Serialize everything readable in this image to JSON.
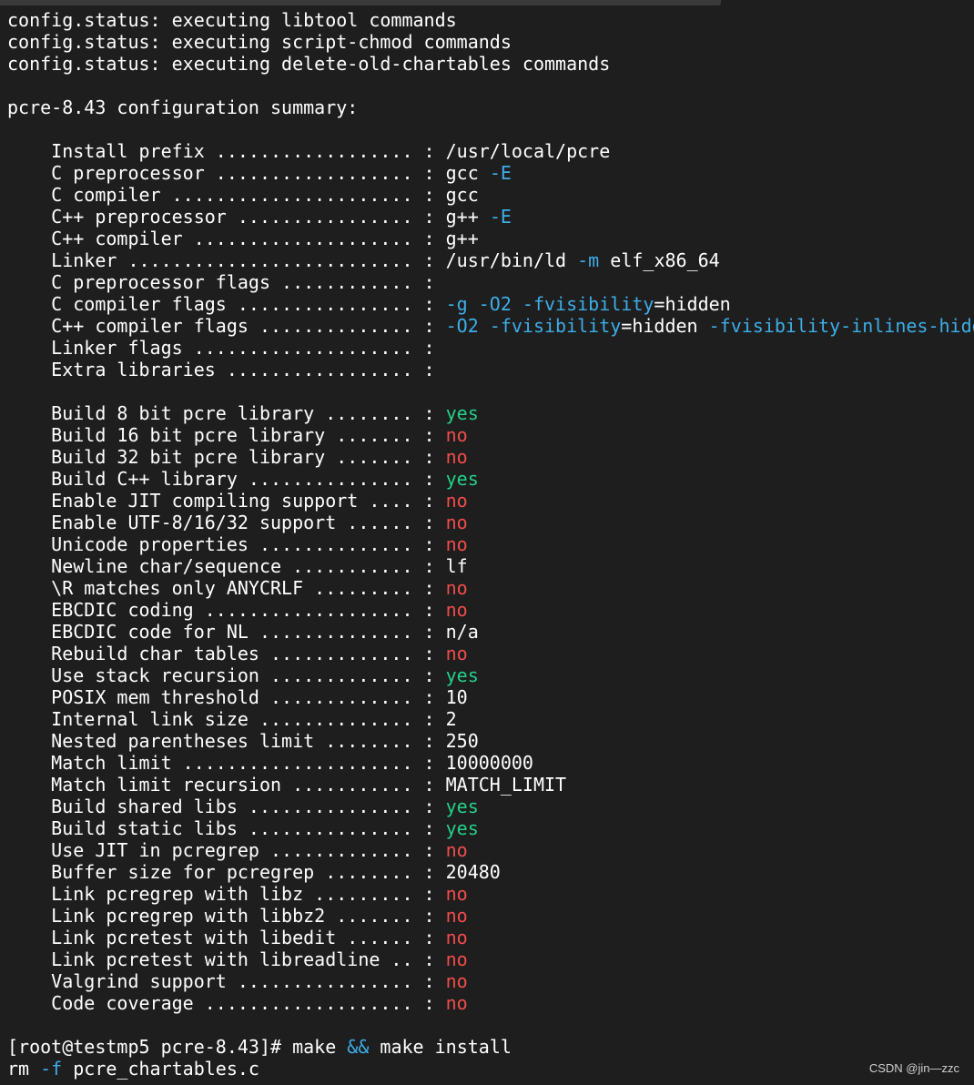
{
  "colors": {
    "background": "#1e1e1e",
    "white": "#ffffff",
    "blue": "#3daee9",
    "green": "#23d18b",
    "red": "#f14c4c"
  },
  "terminal": {
    "lines": [
      [
        {
          "t": "config.status: executing libtool commands",
          "c": "white"
        }
      ],
      [
        {
          "t": "config.status: executing script-chmod commands",
          "c": "white"
        }
      ],
      [
        {
          "t": "config.status: executing delete-old-chartables commands",
          "c": "white"
        }
      ],
      [],
      [
        {
          "t": "pcre-8.43 configuration summary:",
          "c": "white"
        }
      ],
      [],
      [
        {
          "t": "    Install prefix .................. : /usr/local/pcre",
          "c": "white"
        }
      ],
      [
        {
          "t": "    C preprocessor .................. : gcc ",
          "c": "white"
        },
        {
          "t": "-E",
          "c": "blue"
        }
      ],
      [
        {
          "t": "    C compiler ...................... : gcc",
          "c": "white"
        }
      ],
      [
        {
          "t": "    C++ preprocessor ................ : g++ ",
          "c": "white"
        },
        {
          "t": "-E",
          "c": "blue"
        }
      ],
      [
        {
          "t": "    C++ compiler .................... : g++",
          "c": "white"
        }
      ],
      [
        {
          "t": "    Linker .......................... : /usr/bin/ld ",
          "c": "white"
        },
        {
          "t": "-m",
          "c": "blue"
        },
        {
          "t": " elf_x86_64",
          "c": "white"
        }
      ],
      [
        {
          "t": "    C preprocessor flags ............ :",
          "c": "white"
        }
      ],
      [
        {
          "t": "    C compiler flags ................ : ",
          "c": "white"
        },
        {
          "t": "-g -O2 -fvisibility",
          "c": "blue"
        },
        {
          "t": "=hidden",
          "c": "white"
        }
      ],
      [
        {
          "t": "    C++ compiler flags .............. : ",
          "c": "white"
        },
        {
          "t": "-O2 -fvisibility",
          "c": "blue"
        },
        {
          "t": "=hidden ",
          "c": "white"
        },
        {
          "t": "-fvisibility-inlines-hidd",
          "c": "blue"
        }
      ],
      [
        {
          "t": "    Linker flags .................... :",
          "c": "white"
        }
      ],
      [
        {
          "t": "    Extra libraries ................. :",
          "c": "white"
        }
      ],
      [],
      [
        {
          "t": "    Build 8 bit pcre library ........ : ",
          "c": "white"
        },
        {
          "t": "yes",
          "c": "green"
        }
      ],
      [
        {
          "t": "    Build 16 bit pcre library ....... : ",
          "c": "white"
        },
        {
          "t": "no",
          "c": "red"
        }
      ],
      [
        {
          "t": "    Build 32 bit pcre library ....... : ",
          "c": "white"
        },
        {
          "t": "no",
          "c": "red"
        }
      ],
      [
        {
          "t": "    Build C++ library ............... : ",
          "c": "white"
        },
        {
          "t": "yes",
          "c": "green"
        }
      ],
      [
        {
          "t": "    Enable JIT compiling support .... : ",
          "c": "white"
        },
        {
          "t": "no",
          "c": "red"
        }
      ],
      [
        {
          "t": "    Enable UTF-8/16/32 support ...... : ",
          "c": "white"
        },
        {
          "t": "no",
          "c": "red"
        }
      ],
      [
        {
          "t": "    Unicode properties .............. : ",
          "c": "white"
        },
        {
          "t": "no",
          "c": "red"
        }
      ],
      [
        {
          "t": "    Newline char/sequence ........... : lf",
          "c": "white"
        }
      ],
      [
        {
          "t": "    \\R matches only ANYCRLF ......... : ",
          "c": "white"
        },
        {
          "t": "no",
          "c": "red"
        }
      ],
      [
        {
          "t": "    EBCDIC coding ................... : ",
          "c": "white"
        },
        {
          "t": "no",
          "c": "red"
        }
      ],
      [
        {
          "t": "    EBCDIC code for NL .............. : n/a",
          "c": "white"
        }
      ],
      [
        {
          "t": "    Rebuild char tables ............. : ",
          "c": "white"
        },
        {
          "t": "no",
          "c": "red"
        }
      ],
      [
        {
          "t": "    Use stack recursion ............. : ",
          "c": "white"
        },
        {
          "t": "yes",
          "c": "green"
        }
      ],
      [
        {
          "t": "    POSIX mem threshold ............. : 10",
          "c": "white"
        }
      ],
      [
        {
          "t": "    Internal link size .............. : 2",
          "c": "white"
        }
      ],
      [
        {
          "t": "    Nested parentheses limit ........ : 250",
          "c": "white"
        }
      ],
      [
        {
          "t": "    Match limit ..................... : 10000000",
          "c": "white"
        }
      ],
      [
        {
          "t": "    Match limit recursion ........... : MATCH_LIMIT",
          "c": "white"
        }
      ],
      [
        {
          "t": "    Build shared libs ............... : ",
          "c": "white"
        },
        {
          "t": "yes",
          "c": "green"
        }
      ],
      [
        {
          "t": "    Build static libs ............... : ",
          "c": "white"
        },
        {
          "t": "yes",
          "c": "green"
        }
      ],
      [
        {
          "t": "    Use JIT in pcregrep ............. : ",
          "c": "white"
        },
        {
          "t": "no",
          "c": "red"
        }
      ],
      [
        {
          "t": "    Buffer size for pcregrep ........ : 20480",
          "c": "white"
        }
      ],
      [
        {
          "t": "    Link pcregrep with libz ......... : ",
          "c": "white"
        },
        {
          "t": "no",
          "c": "red"
        }
      ],
      [
        {
          "t": "    Link pcregrep with libbz2 ....... : ",
          "c": "white"
        },
        {
          "t": "no",
          "c": "red"
        }
      ],
      [
        {
          "t": "    Link pcretest with libedit ...... : ",
          "c": "white"
        },
        {
          "t": "no",
          "c": "red"
        }
      ],
      [
        {
          "t": "    Link pcretest with libreadline .. : ",
          "c": "white"
        },
        {
          "t": "no",
          "c": "red"
        }
      ],
      [
        {
          "t": "    Valgrind support ................ : ",
          "c": "white"
        },
        {
          "t": "no",
          "c": "red"
        }
      ],
      [
        {
          "t": "    Code coverage ................... : ",
          "c": "white"
        },
        {
          "t": "no",
          "c": "red"
        }
      ],
      [],
      [
        {
          "t": "[root@testmp5 pcre-8.43]# make ",
          "c": "white"
        },
        {
          "t": "&&",
          "c": "blue"
        },
        {
          "t": " make install",
          "c": "white"
        }
      ],
      [
        {
          "t": "rm ",
          "c": "white"
        },
        {
          "t": "-f",
          "c": "blue"
        },
        {
          "t": " pcre_chartables.c",
          "c": "white"
        }
      ]
    ]
  },
  "watermark": {
    "text": "CSDN @jin—zzc"
  }
}
